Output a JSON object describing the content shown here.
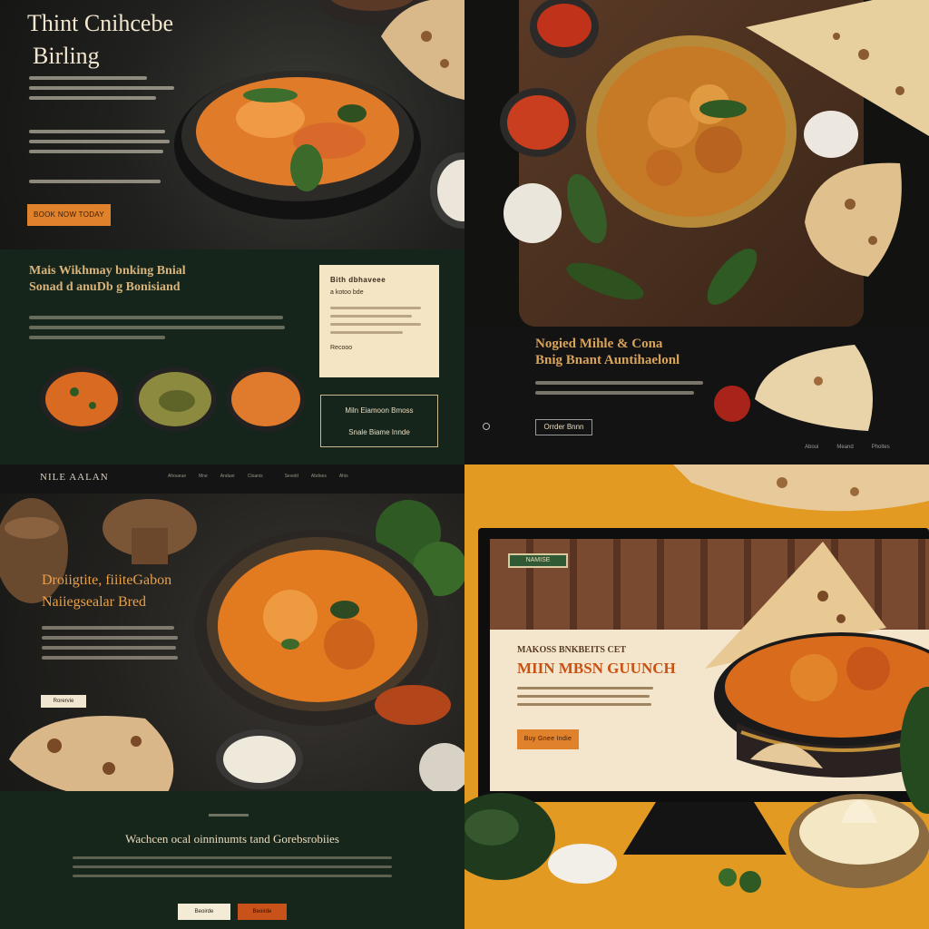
{
  "panel1": {
    "title_line1": "Thint Cnihcebe",
    "title_line2": "Birling",
    "cta": "BOOK NOW TODAY",
    "section_heading_line1": "Mais Wikhmay bnking Bnial",
    "section_heading_line2": "Sonad d anuDb g Bonisiand",
    "card_title": "Bith dbhaveee",
    "card_sub": "a kotoo bde",
    "card_link": "Recooo",
    "box_line1": "Miln Eiamoon Bmoss",
    "box_line2": "Snale Biame Innde"
  },
  "panel2": {
    "heading_line1": "Nogied Mihle & Cona",
    "heading_line2": "Bnig Bnant Auntihaelonl",
    "button": "Orrder Bnnn",
    "footer_links": [
      "Aboui",
      "Meand",
      "Pholtes"
    ]
  },
  "panel3": {
    "brand": "NILE AALAN",
    "nav": [
      "Ahoueue",
      "Mne",
      "Anduer",
      "Cloanis",
      "Seveld",
      "Abdoes",
      "Ahis"
    ],
    "heading_line1": "Droiigtite, fiiiteGabon",
    "heading_line2": "Naiiegsealar Bred",
    "button": "Rorervie",
    "bottom_heading": "Wachcen ocal oinninumts tand Gorebsrobiies",
    "btn_light": "Beoirde",
    "btn_dark": "Beoirde"
  },
  "panel4": {
    "brand_tag": "NAMISE",
    "heading_line1": "MAKOSS BNKBEITS CET",
    "heading_line2": "MIIN MBSN GUUNCH",
    "button": "Buy Gnee Indie"
  },
  "colors": {
    "orange": "#e0822c",
    "dark_green": "#16251b",
    "cream": "#f4e5c4",
    "mustard": "#e29a23"
  }
}
